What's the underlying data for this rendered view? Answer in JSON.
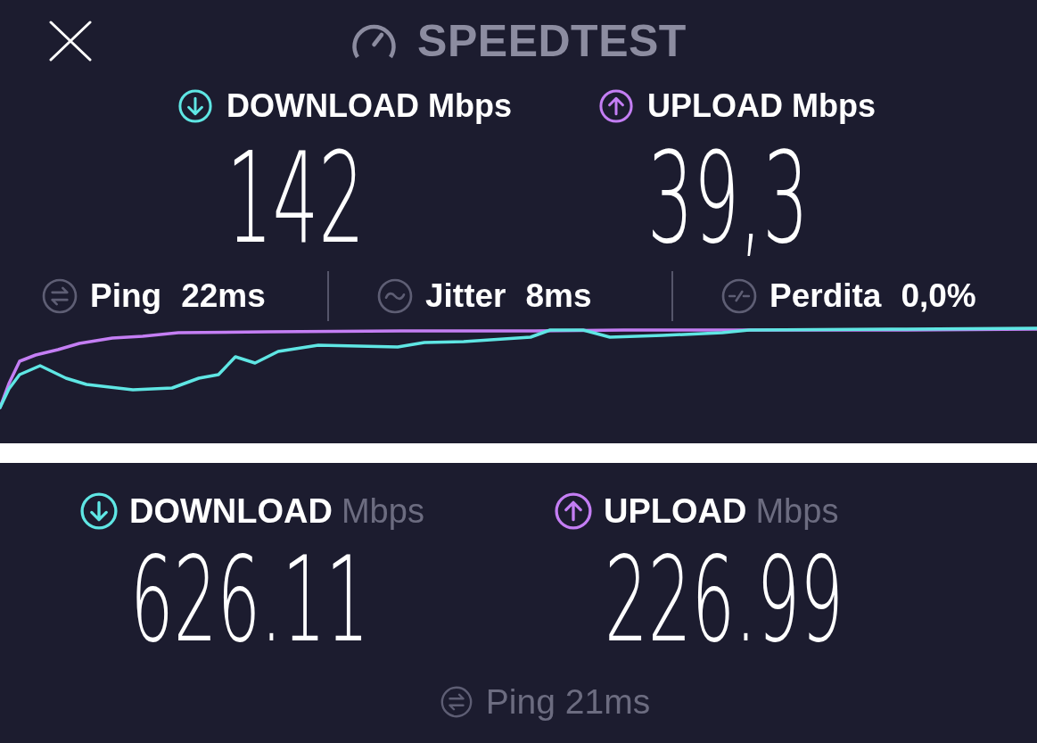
{
  "top_panel": {
    "title": "SPEEDTEST",
    "results": [
      {
        "kind": "download",
        "label": "DOWNLOAD",
        "unit": "Mbps",
        "value": "142"
      },
      {
        "kind": "upload",
        "label": "UPLOAD",
        "unit": "Mbps",
        "value": "39,3"
      }
    ],
    "metrics": [
      {
        "kind": "ping",
        "label": "Ping",
        "value": "22ms"
      },
      {
        "kind": "jitter",
        "label": "Jitter",
        "value": "8ms"
      },
      {
        "kind": "loss",
        "label": "Perdita",
        "value": "0,0%"
      }
    ]
  },
  "bottom_panel": {
    "results": [
      {
        "kind": "download",
        "label": "DOWNLOAD",
        "unit": "Mbps",
        "value": "626.11"
      },
      {
        "kind": "upload",
        "label": "UPLOAD",
        "unit": "Mbps",
        "value": "226.99"
      }
    ],
    "ping": {
      "kind": "ping",
      "label": "Ping",
      "value": "21ms"
    }
  }
}
